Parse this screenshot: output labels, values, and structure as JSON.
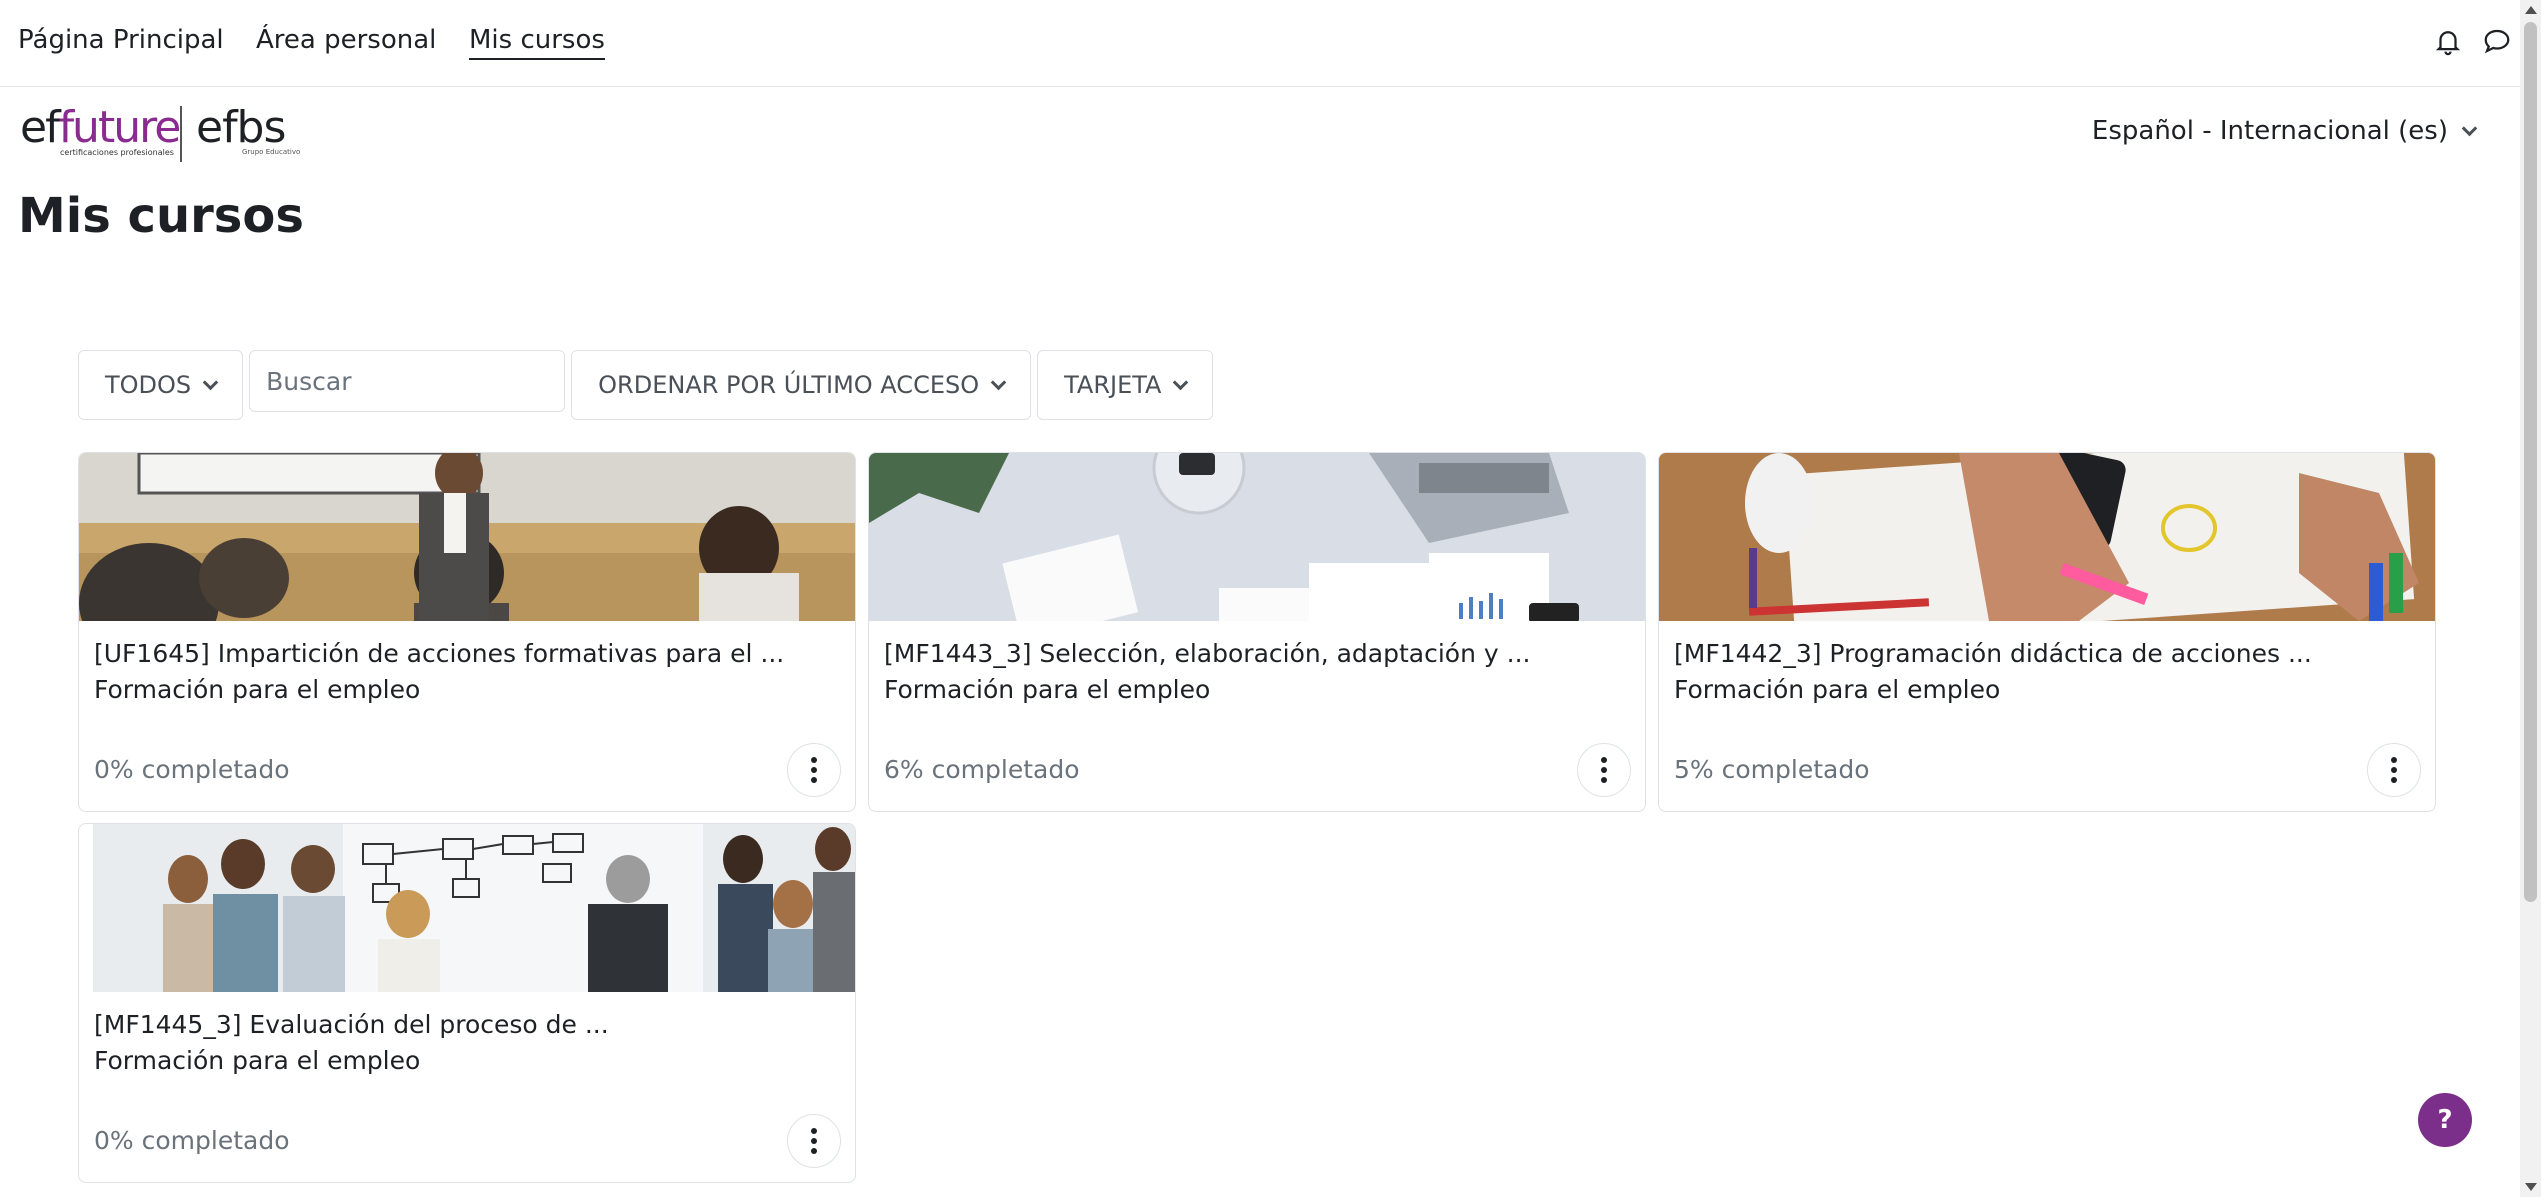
{
  "nav": {
    "items": [
      {
        "label": "Página Principal"
      },
      {
        "label": "Área personal"
      },
      {
        "label": "Mis cursos"
      }
    ]
  },
  "logo": {
    "brand_prefix": "ef",
    "brand_suffix": "future",
    "tagline": "certificaciones profesionales",
    "partner": "efbs",
    "partner_tagline": "Grupo Educativo"
  },
  "language": {
    "selected": "Español - Internacional (es)"
  },
  "page": {
    "title": "Mis cursos"
  },
  "toolbar": {
    "filter_label": "TODOS",
    "search_placeholder": "Buscar",
    "sort_label": "ORDENAR POR ÚLTIMO ACCESO",
    "view_label": "TARJETA"
  },
  "courses": [
    {
      "title": "[UF1645] Impartición de acciones formativas para el ...",
      "category": "Formación para el empleo",
      "progress_text": "0% completado",
      "progress": 0
    },
    {
      "title": "[MF1443_3] Selección, elaboración, adaptación y ...",
      "category": "Formación para el empleo",
      "progress_text": "6% completado",
      "progress": 6
    },
    {
      "title": "[MF1442_3] Programación didáctica de acciones ...",
      "category": "Formación para el empleo",
      "progress_text": "5% completado",
      "progress": 5
    },
    {
      "title": "[MF1445_3] Evaluación del proceso de ...",
      "category": "Formación para el empleo",
      "progress_text": "0% completado",
      "progress": 0
    }
  ],
  "help": {
    "label": "?"
  },
  "colors": {
    "brand": "#8a2b8f",
    "help_button": "#7b2f8a",
    "muted_text": "#6a737b"
  }
}
